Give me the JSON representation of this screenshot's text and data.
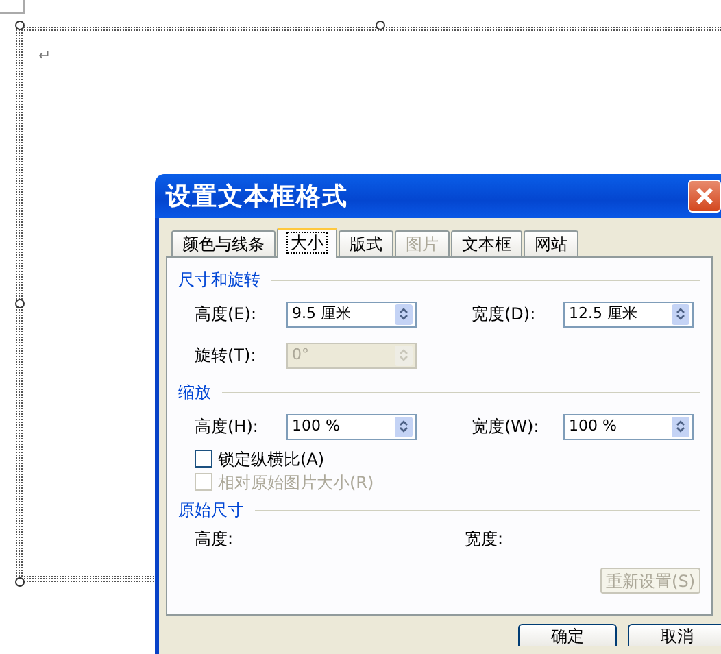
{
  "document": {
    "paragraph_mark": "↵"
  },
  "dialog": {
    "title": "设置文本框格式",
    "tabs": [
      {
        "label": "颜色与线条",
        "selected": false,
        "disabled": false
      },
      {
        "label": "大小",
        "selected": true,
        "disabled": false
      },
      {
        "label": "版式",
        "selected": false,
        "disabled": false
      },
      {
        "label": "图片",
        "selected": false,
        "disabled": true
      },
      {
        "label": "文本框",
        "selected": false,
        "disabled": false
      },
      {
        "label": "网站",
        "selected": false,
        "disabled": false
      }
    ],
    "sections": [
      {
        "title": "尺寸和旋转",
        "rows": [
          [
            {
              "label": "高度(E):",
              "value": "9.5 厘米",
              "disabled": false
            },
            {
              "label": "宽度(D):",
              "value": "12.5 厘米",
              "disabled": false
            }
          ],
          [
            {
              "label": "旋转(T):",
              "value": "0°",
              "disabled": true
            }
          ]
        ]
      },
      {
        "title": "缩放",
        "rows": [
          [
            {
              "label": "高度(H):",
              "value": "100 %",
              "disabled": false
            },
            {
              "label": "宽度(W):",
              "value": "100 %",
              "disabled": false
            }
          ]
        ],
        "checkboxes": [
          {
            "label": "锁定纵横比(A)",
            "checked": false,
            "disabled": false
          },
          {
            "label": "相对原始图片大小(R)",
            "checked": false,
            "disabled": true
          }
        ]
      },
      {
        "title": "原始尺寸",
        "labels": [
          "高度:",
          "宽度:"
        ],
        "button": {
          "label": "重新设置(S)",
          "disabled": true
        }
      }
    ],
    "buttons": [
      "确定",
      "取消"
    ]
  }
}
